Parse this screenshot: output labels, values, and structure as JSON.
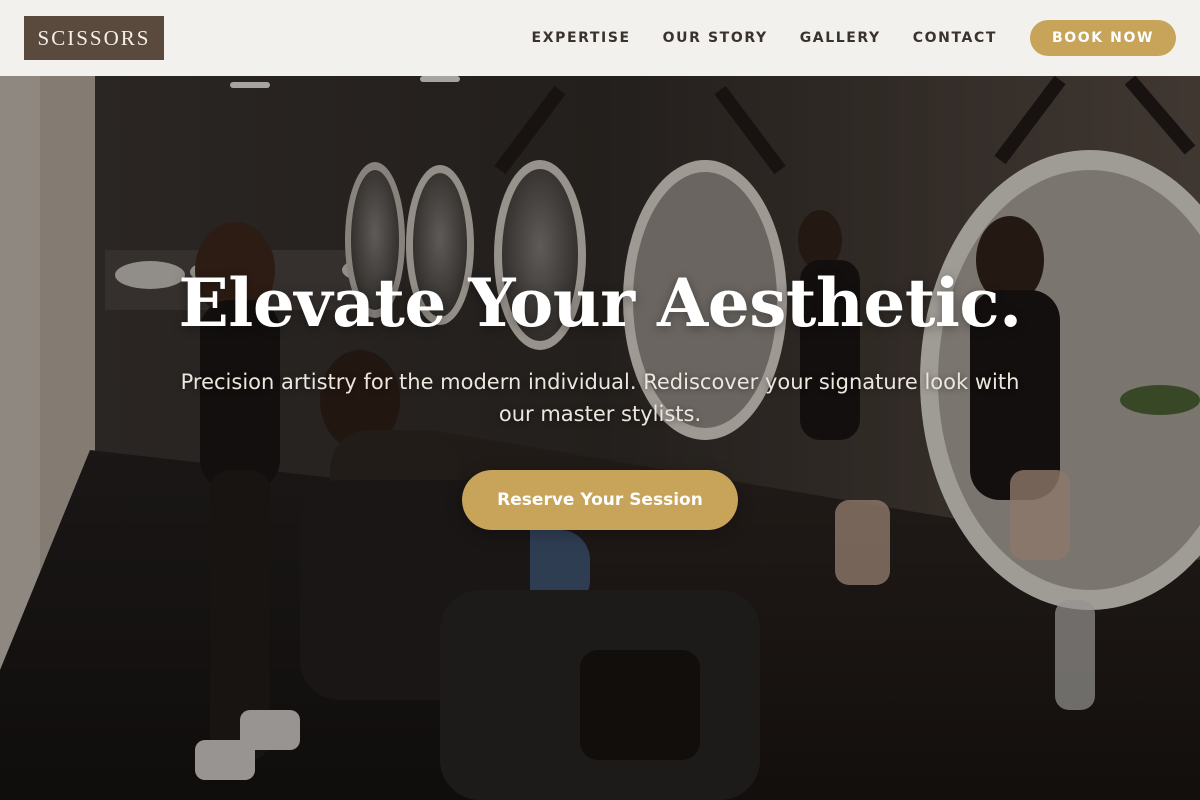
{
  "brand": {
    "logo_text": "SCISSORS"
  },
  "nav": {
    "items": [
      {
        "label": "EXPERTISE"
      },
      {
        "label": "OUR STORY"
      },
      {
        "label": "GALLERY"
      },
      {
        "label": "CONTACT"
      }
    ],
    "cta_label": "BOOK NOW"
  },
  "hero": {
    "title": "Elevate Your Aesthetic.",
    "subtitle": "Precision artistry for the modern individual. Rediscover your signature look with our master stylists.",
    "cta_label": "Reserve Your Session",
    "background_icon": "salon-interior-photo"
  },
  "colors": {
    "accent": "#c8a35a",
    "logo_bg": "#5a4a3e",
    "header_bg": "#f2f1ee",
    "nav_text": "#3a332d"
  }
}
